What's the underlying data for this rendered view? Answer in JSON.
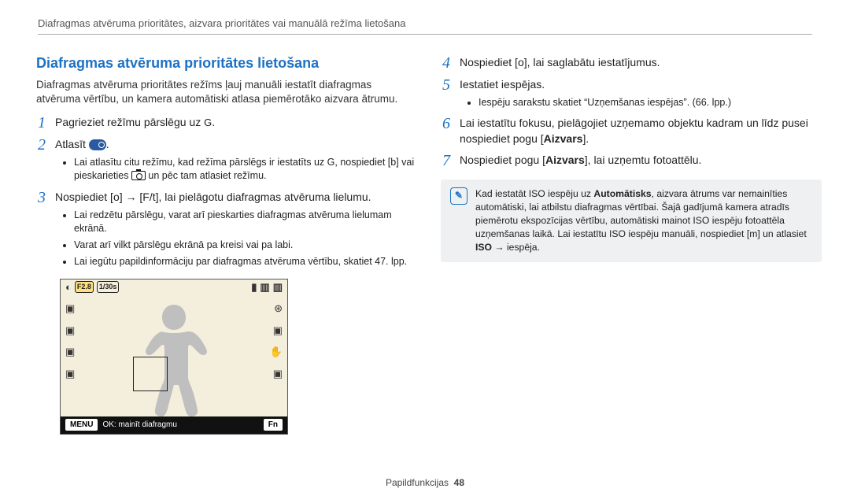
{
  "page_header": "Diafragmas atvēruma prioritātes, aizvara prioritātes vai manuālā režīma lietošana",
  "section_title": "Diafragmas atvēruma prioritātes lietošana",
  "intro": "Diafragmas atvēruma prioritātes režīms ļauj manuāli iestatīt diafragmas atvēruma vērtību, un kamera automātiski atlasa piemērotāko aizvara ātrumu.",
  "steps": {
    "s1": {
      "num": "1",
      "text_a": "Pagrieziet režīmu pārslēgu uz ",
      "glyph": "G",
      "text_b": "."
    },
    "s2": {
      "num": "2",
      "text_a": "Atlasīt ",
      "text_b": "."
    },
    "s2_sub": {
      "a": "Lai atlasītu citu režīmu, kad režīma pārslēgs ir iestatīts uz ",
      "g": "G",
      "b": ", nospiediet [",
      "c": "b",
      "d": "] vai pieskarieties ",
      "e": " un pēc tam atlasiet režīmu."
    },
    "s3": {
      "num": "3",
      "text_a": "Nospiediet [",
      "o": "o",
      "text_b": "] → [",
      "ft": "F/t",
      "text_c": "], lai pielāgotu diafragmas atvēruma lielumu."
    },
    "s3_sub": {
      "a": "Lai redzētu pārslēgu, varat arī pieskarties diafragmas atvēruma lielumam ekrānā.",
      "b": "Varat arī vilkt pārslēgu ekrānā pa kreisi vai pa labi.",
      "c": "Lai iegūtu papildinformāciju par diafragmas atvēruma vērtību, skatiet 47. lpp."
    },
    "s4": {
      "num": "4",
      "text_a": "Nospiediet [",
      "o": "o",
      "text_b": "], lai saglabātu iestatījumus."
    },
    "s5": {
      "num": "5",
      "text": "Iestatiet iespējas."
    },
    "s5_sub": {
      "a": "Iespēju sarakstu skatiet “Uzņemšanas iespējas”. (66. lpp.)"
    },
    "s6": {
      "num": "6",
      "text_a": "Lai iestatītu fokusu, pielāgojiet uzņemamo objektu kadram un līdz pusei nospiediet pogu [",
      "bold": "Aizvars",
      "text_b": "]."
    },
    "s7": {
      "num": "7",
      "text_a": "Nospiediet pogu [",
      "bold": "Aizvars",
      "text_b": "], lai uzņemtu fotoattēlu."
    }
  },
  "note": {
    "a": "Kad iestatāt ISO iespēju uz ",
    "bold1": "Automātisks",
    "b": ", aizvara ātrums var nemainīties automātiski, lai atbilstu diafragmas vērtībai. Šajā gadījumā kamera atradīs piemērotu ekspozīcijas vērtību, automātiski mainot ISO iespēju fotoattēla uzņemšanas laikā. Lai iestatītu ISO iespēju manuāli, nospiediet [",
    "m": "m",
    "c": "] un atlasiet ",
    "bold2": "ISO",
    "d": " → iespēja."
  },
  "lcd": {
    "f": "F2.8",
    "shutter": "1/30s",
    "menu": "MENU",
    "ok": "OK: mainīt diafragmu",
    "fn": "Fn"
  },
  "footer": {
    "label": "Papildfunkcijas",
    "page": "48"
  }
}
